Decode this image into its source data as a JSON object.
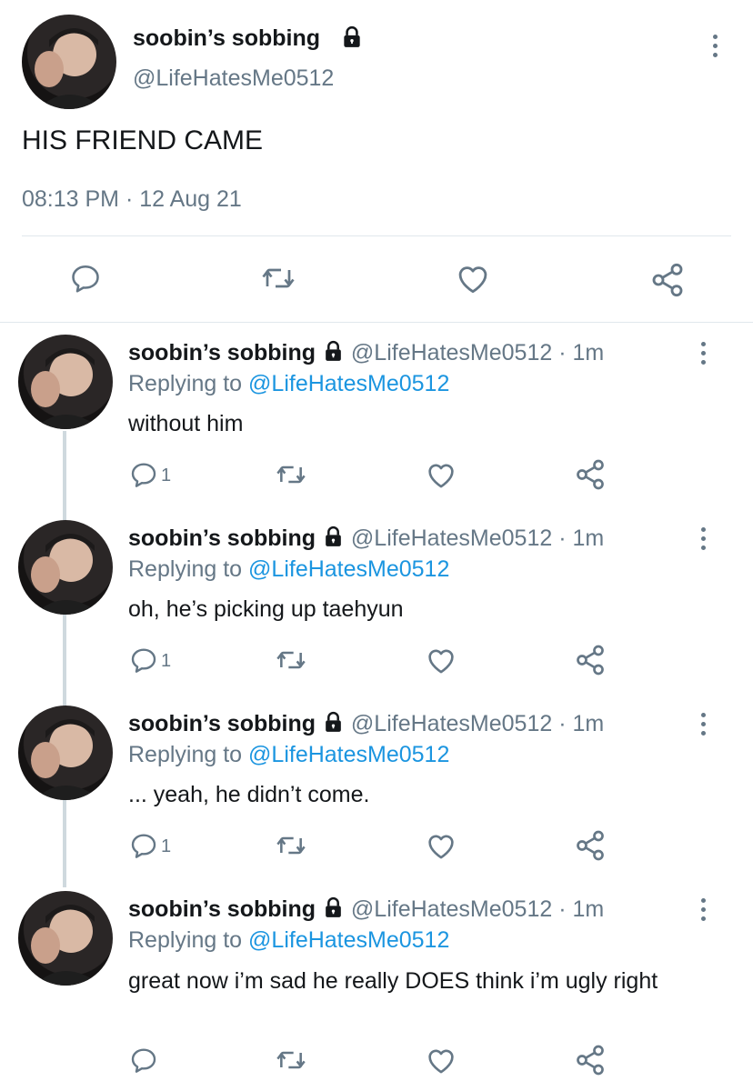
{
  "main_tweet": {
    "display_name": "soobin’s sobbing",
    "handle": "@LifeHatesMe0512",
    "text": "HIS FRIEND CAME",
    "timestamp": "08:13 PM · 12 Aug 21",
    "icons": [
      "lock-icon",
      "more-icon",
      "reply-icon",
      "retweet-icon",
      "like-icon",
      "share-icon"
    ]
  },
  "replies": [
    {
      "display_name": "soobin’s sobbing",
      "handle_time": "@LifeHatesMe0512 · 1m",
      "replying_prefix": "Replying to",
      "replying_handle": "@LifeHatesMe0512",
      "text": "without him",
      "reply_count": "1"
    },
    {
      "display_name": "soobin’s sobbing",
      "handle_time": "@LifeHatesMe0512 · 1m",
      "replying_prefix": "Replying to",
      "replying_handle": "@LifeHatesMe0512",
      "text": "oh, he’s picking up taehyun",
      "reply_count": "1"
    },
    {
      "display_name": "soobin’s sobbing",
      "handle_time": "@LifeHatesMe0512 · 1m",
      "replying_prefix": "Replying to",
      "replying_handle": "@LifeHatesMe0512",
      "text": "... yeah, he didn’t come.",
      "reply_count": "1"
    },
    {
      "display_name": "soobin’s sobbing",
      "handle_time": "@LifeHatesMe0512 · 1m",
      "replying_prefix": "Replying to",
      "replying_handle": "@LifeHatesMe0512",
      "text": "great now i’m sad he really DOES think i’m ugly right",
      "reply_count": ""
    }
  ],
  "colors": {
    "text": "#14171a",
    "muted": "#657786",
    "link": "#1b95e0",
    "divider": "#e1e8ed"
  }
}
